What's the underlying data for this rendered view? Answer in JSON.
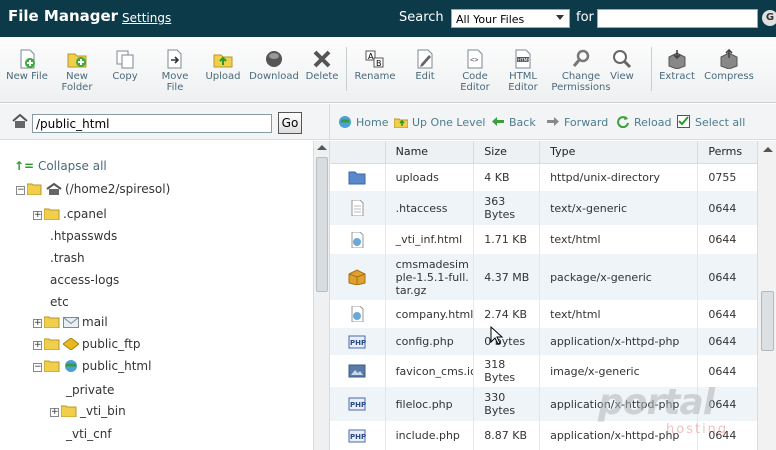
{
  "header": {
    "title": "File Manager",
    "settings_label": "Settings",
    "search_label": "Search",
    "search_scope": "All Your Files",
    "for_label": "for",
    "search_value": ""
  },
  "toolbar": {
    "buttons": [
      {
        "label": "New File",
        "icon": "new-file-icon"
      },
      {
        "label": "New Folder",
        "icon": "new-folder-icon"
      },
      {
        "label": "Copy",
        "icon": "copy-icon"
      },
      {
        "label": "Move File",
        "icon": "move-file-icon"
      },
      {
        "label": "Upload",
        "icon": "upload-icon"
      },
      {
        "label": "Download",
        "icon": "download-icon"
      },
      {
        "label": "Delete",
        "icon": "delete-icon"
      },
      {
        "label": "Rename",
        "icon": "rename-icon"
      },
      {
        "label": "Edit",
        "icon": "edit-icon"
      },
      {
        "label": "Code Editor",
        "icon": "code-editor-icon"
      },
      {
        "label": "HTML Editor",
        "icon": "html-editor-icon"
      },
      {
        "label": "Change Permissions",
        "icon": "permissions-icon"
      },
      {
        "label": "View",
        "icon": "view-icon"
      },
      {
        "label": "Extract",
        "icon": "extract-icon"
      },
      {
        "label": "Compress",
        "icon": "compress-icon"
      }
    ]
  },
  "pathbar": {
    "path": "/public_html",
    "go_label": "Go"
  },
  "nav": {
    "home": "Home",
    "up": "Up One Level",
    "back": "Back",
    "forward": "Forward",
    "reload": "Reload",
    "select_all": "Select all"
  },
  "tree": {
    "collapse_all": "Collapse all",
    "root": "(/home2/spiresol)",
    "nodes": [
      ".cpanel",
      ".htpasswds",
      ".trash",
      "access-logs",
      "etc",
      "mail",
      "public_ftp",
      "public_html",
      "_private",
      "_vti_bin",
      "_vti_cnf"
    ]
  },
  "table": {
    "headers": {
      "name": "Name",
      "size": "Size",
      "type": "Type",
      "perms": "Perms"
    },
    "rows": [
      {
        "name": "uploads",
        "size": "4 KB",
        "type": "httpd/unix-directory",
        "perms": "0755",
        "icon": "folder-icon"
      },
      {
        "name": ".htaccess",
        "size": "363 Bytes",
        "type": "text/x-generic",
        "perms": "0644",
        "icon": "text-file-icon"
      },
      {
        "name": "_vti_inf.html",
        "size": "1.71 KB",
        "type": "text/html",
        "perms": "0644",
        "icon": "html-file-icon"
      },
      {
        "name": "cmsmadesimple-1.5.1-full.tar.gz",
        "size": "4.37 MB",
        "type": "package/x-generic",
        "perms": "0644",
        "icon": "package-icon"
      },
      {
        "name": "company.html",
        "size": "2.74 KB",
        "type": "text/html",
        "perms": "0644",
        "icon": "html-file-icon"
      },
      {
        "name": "config.php",
        "size": "0 bytes",
        "type": "application/x-httpd-php",
        "perms": "0644",
        "icon": "php-file-icon"
      },
      {
        "name": "favicon_cms.ico",
        "size": "318 Bytes",
        "type": "image/x-generic",
        "perms": "0644",
        "icon": "image-file-icon"
      },
      {
        "name": "fileloc.php",
        "size": "330 Bytes",
        "type": "application/x-httpd-php",
        "perms": "0644",
        "icon": "php-file-icon"
      },
      {
        "name": "include.php",
        "size": "8.87 KB",
        "type": "application/x-httpd-php",
        "perms": "0644",
        "icon": "php-file-icon"
      }
    ]
  },
  "watermark": {
    "brand": "portal",
    "sub": "hosting"
  }
}
